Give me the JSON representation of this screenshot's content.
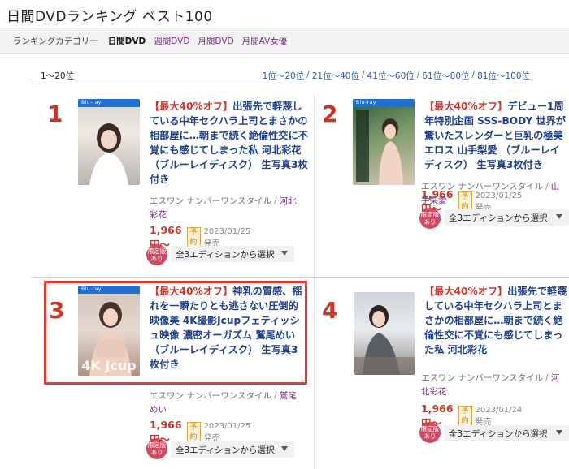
{
  "page": {
    "title": "日間DVDランキング ベスト100"
  },
  "categories": {
    "label": "ランキングカテゴリー",
    "active": "日間DVD",
    "links": [
      "週間DVD",
      "月間DVD",
      "月間AV女優"
    ]
  },
  "range": {
    "current": "1〜20位",
    "pages": [
      "1位〜20位",
      "21位〜40位",
      "41位〜60位",
      "61位〜80位",
      "81位〜100位"
    ]
  },
  "items": [
    {
      "rank": "1",
      "promo": "【最大40%オフ】",
      "title": "出張先で軽蔑している中年セクハラ上司とまさかの相部屋に…朝まで続く絶倫性交に不覚にも感じてしまった私 河北彩花 （ブルーレイディスク） 生写真3枚付き",
      "studio": "エスワン ナンバーワンスタイル",
      "actress": "河北彩花",
      "price": "1,966円〜",
      "badge": "予約",
      "release": "2023/01/25発売",
      "limited": "限定版あり",
      "edition": "全3エディションから選択"
    },
    {
      "rank": "2",
      "promo": "【最大40%オフ】",
      "title": "デビュー1周年特別企画 SSS-BODY 世界が驚いたスレンダーと巨乳の極美エロス 山手梨愛 （ブルーレイディスク） 生写真3枚付き",
      "studio": "エスワン ナンバーワンスタイル",
      "actress": "山手梨愛",
      "price": "1,966円〜",
      "badge": "予約",
      "release": "2023/01/25発売",
      "limited": "限定版あり",
      "edition": "全3エディションから選択"
    },
    {
      "rank": "3",
      "promo": "【最大40%オフ】",
      "title": "神乳の質感、揺れを一瞬たりとも逃さない圧倒的映像美 4K撮影Jcupフェティッシュ映像 濃密オーガズム 鷲尾めい （ブルーレイディスク） 生写真3枚付き",
      "studio": "エスワン ナンバーワンスタイル",
      "actress": "鷲尾めい",
      "price": "1,966円〜",
      "badge": "予約",
      "release": "2023/01/25発売",
      "limited": "限定版あり",
      "edition": "全3エディションから選択"
    },
    {
      "rank": "4",
      "promo": "【最大40%オフ】",
      "title": "出張先で軽蔑している中年セクハラ上司とまさかの相部屋に…朝まで続く絶倫性交に不覚にも感じてしまった私 河北彩花",
      "studio": "エスワン ナンバーワンスタイル",
      "actress": "河北彩花",
      "price": "1,966円〜",
      "badge": "予約",
      "release": "2023/01/24発売",
      "limited": "限定版あり",
      "edition": "全3エディションから選択"
    }
  ],
  "colors": {
    "rank": "#c0392b",
    "title_link": "#1f3f8a",
    "promo": "#d0362b",
    "actress_link": "#7b2b87",
    "highlight": "#e53935"
  }
}
